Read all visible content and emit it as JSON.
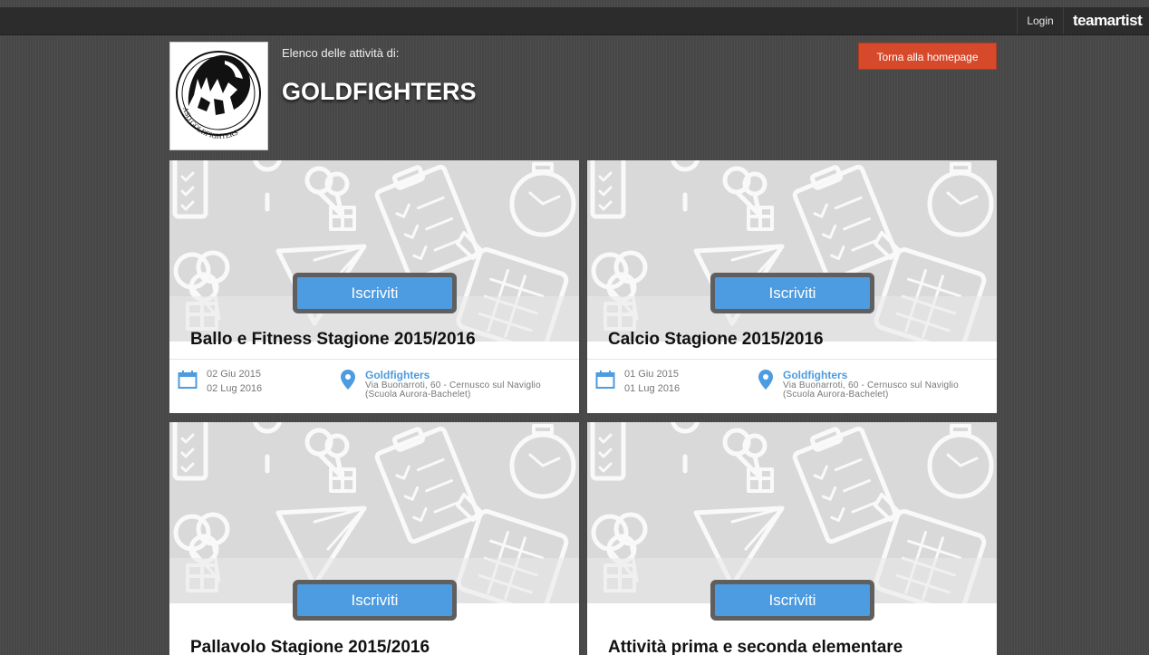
{
  "topbar": {
    "login": "Login",
    "brand": "teamartist"
  },
  "header": {
    "subtitle": "Elenco delle attività di:",
    "title": "GOLDFIGHTERS",
    "home_button": "Torna alla homepage",
    "logo_text": "ASD GOLDFIGHTERS"
  },
  "colors": {
    "accent": "#4d9be0",
    "home_button": "#d6492b",
    "background": "#474747"
  },
  "cards": [
    {
      "button": "Iscriviti",
      "title": "Ballo e Fitness Stagione 2015/2016",
      "date_start": "02 Giu 2015",
      "date_end": "02 Lug 2016",
      "venue": "Goldfighters",
      "address": "Via Buonarroti, 60 - Cernusco sul Naviglio   (Scuola Aurora-Bachelet)"
    },
    {
      "button": "Iscriviti",
      "title": "Calcio Stagione 2015/2016",
      "date_start": "01 Giu 2015",
      "date_end": "01 Lug 2016",
      "venue": "Goldfighters",
      "address": "Via Buonarroti, 60 - Cernusco sul Naviglio   (Scuola Aurora-Bachelet)"
    },
    {
      "button": "Iscriviti",
      "title": "Pallavolo Stagione 2015/2016"
    },
    {
      "button": "Iscriviti",
      "title": "Attività prima e seconda elementare"
    }
  ]
}
